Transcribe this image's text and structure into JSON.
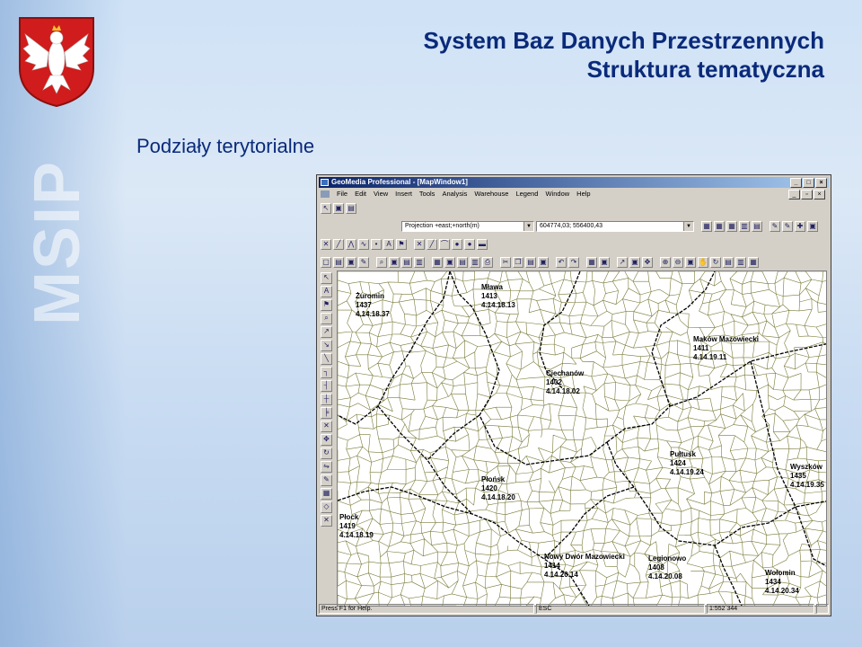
{
  "slide": {
    "title_line1": "System Baz Danych Przestrzennych",
    "title_line2": "Struktura tematyczna",
    "subtitle": "Podziały terytorialne",
    "watermark": "MSIP"
  },
  "window": {
    "title": "GeoMedia Professional - [MapWindow1]",
    "controls": [
      "_",
      "□",
      "×"
    ],
    "mdi_controls": [
      "_",
      "▫",
      "×"
    ]
  },
  "menu": [
    "File",
    "Edit",
    "View",
    "Insert",
    "Tools",
    "Analysis",
    "Warehouse",
    "Legend",
    "Window",
    "Help"
  ],
  "projection": {
    "value": "Projection +east;+north(m)",
    "coordinates": "604774,03; 556400,43"
  },
  "status": {
    "help": "Press F1 for Help.",
    "esc": "ESC",
    "scale": "1:552 344"
  },
  "map_labels": [
    {
      "name": "Żuromin",
      "code": "1437",
      "teryt": "4.14.18.37"
    },
    {
      "name": "Mława",
      "code": "1413",
      "teryt": "4.14.18.13"
    },
    {
      "name": "Maków Mazowiecki",
      "code": "1411",
      "teryt": "4.14.19.11"
    },
    {
      "name": "Ciechanów",
      "code": "1402",
      "teryt": "4.14.18.02"
    },
    {
      "name": "Pułtusk",
      "code": "1424",
      "teryt": "4.14.19.24"
    },
    {
      "name": "Wyszków",
      "code": "1435",
      "teryt": "4.14.19.35"
    },
    {
      "name": "Płońsk",
      "code": "1420",
      "teryt": "4.14.18.20"
    },
    {
      "name": "Płock",
      "code": "1419",
      "teryt": "4.14.18.19"
    },
    {
      "name": "Nowy Dwór Mazowiecki",
      "code": "1414",
      "teryt": "4.14.20.14"
    },
    {
      "name": "Legionowo",
      "code": "1408",
      "teryt": "4.14.20.08"
    },
    {
      "name": "Wołomin",
      "code": "1434",
      "teryt": "4.14.20.34"
    }
  ],
  "colors": {
    "title": "#0a2a7a",
    "gmina_border": "#7a7a3a",
    "powiat_border": "#000000",
    "titlebar": "#0a246a"
  }
}
